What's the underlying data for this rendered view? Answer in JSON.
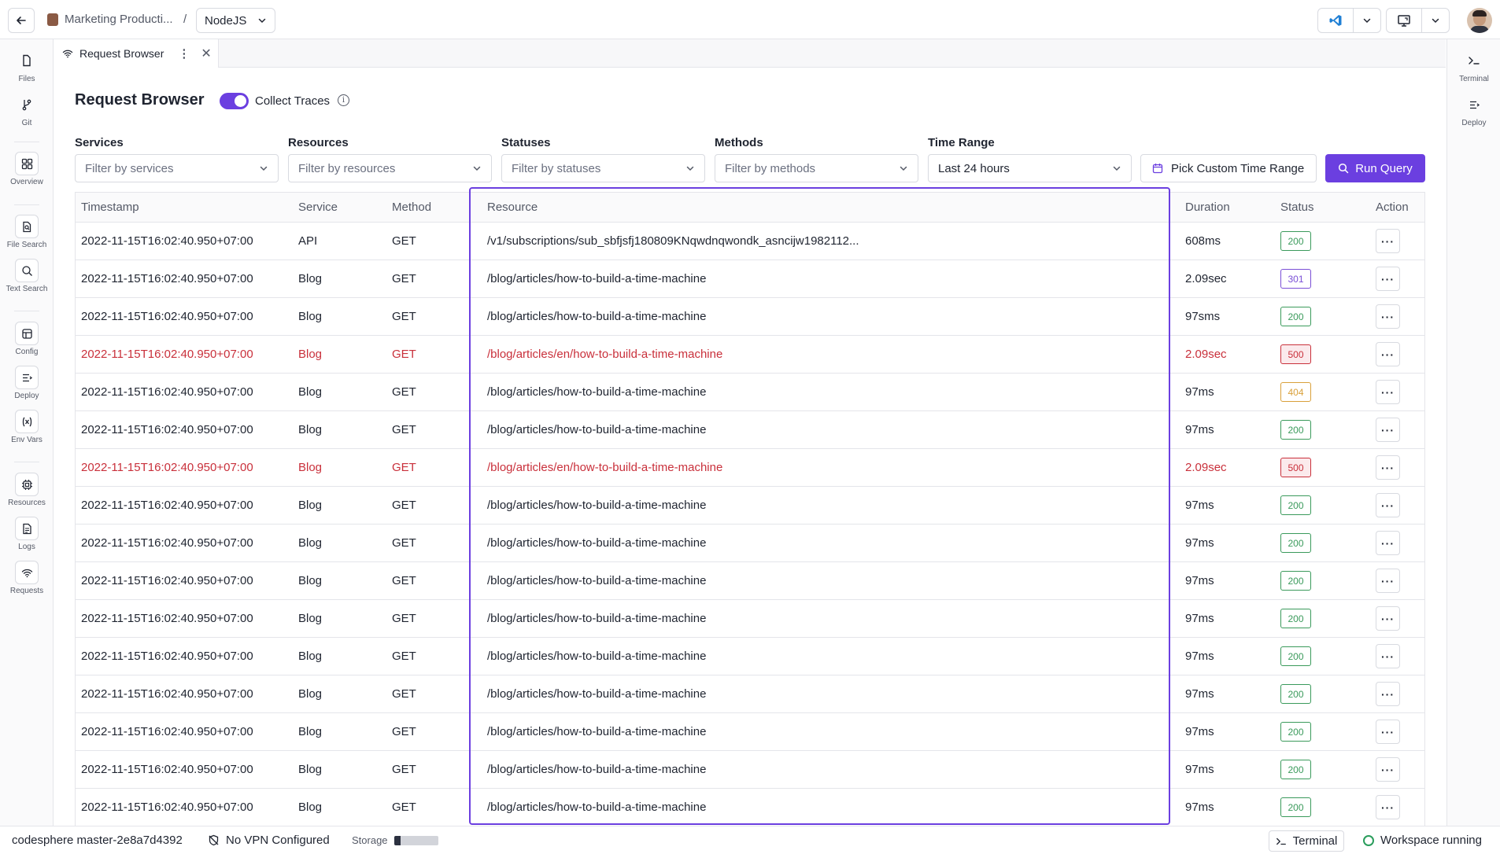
{
  "topbar": {
    "project_name": "Marketing Producti...",
    "separator": "/",
    "env_selected": "NodeJS"
  },
  "leftbar": {
    "items": [
      {
        "label": "Files",
        "icon": "file-icon"
      },
      {
        "label": "Git",
        "icon": "git-branch-icon"
      },
      {
        "label": "Overview",
        "icon": "grid-icon"
      },
      {
        "label": "File Search",
        "icon": "file-search-icon"
      },
      {
        "label": "Text Search",
        "icon": "text-search-icon"
      },
      {
        "label": "Config",
        "icon": "config-icon"
      },
      {
        "label": "Deploy",
        "icon": "deploy-icon"
      },
      {
        "label": "Env Vars",
        "icon": "variable-icon"
      },
      {
        "label": "Resources",
        "icon": "cpu-icon"
      },
      {
        "label": "Logs",
        "icon": "log-icon"
      },
      {
        "label": "Requests",
        "icon": "wifi-icon"
      }
    ]
  },
  "rightbar": {
    "items": [
      {
        "label": "Terminal",
        "icon": "terminal-icon"
      },
      {
        "label": "Deploy",
        "icon": "deploy-icon"
      }
    ]
  },
  "tab": {
    "label": "Request Browser"
  },
  "header": {
    "title": "Request Browser",
    "collect_traces_label": "Collect Traces",
    "collect_traces_on": true
  },
  "filters": {
    "services": {
      "label": "Services",
      "placeholder": "Filter by services"
    },
    "resources": {
      "label": "Resources",
      "placeholder": "Filter by resources"
    },
    "statuses": {
      "label": "Statuses",
      "placeholder": "Filter by statuses"
    },
    "methods": {
      "label": "Methods",
      "placeholder": "Filter by methods"
    },
    "time_range": {
      "label": "Time Range",
      "value": "Last 24 hours"
    },
    "custom_range_label": "Pick Custom Time Range",
    "run_query_label": "Run Query"
  },
  "table": {
    "columns": {
      "timestamp": "Timestamp",
      "service": "Service",
      "method": "Method",
      "resource": "Resource",
      "duration": "Duration",
      "status": "Status",
      "action": "Action"
    },
    "rows": [
      {
        "timestamp": "2022-11-15T16:02:40.950+07:00",
        "service": "API",
        "method": "GET",
        "resource": "/v1/subscriptions/sub_sbfjsfj180809KNqwdnqwondk_asncijw1982112...",
        "duration": "608ms",
        "status": "200",
        "error": false
      },
      {
        "timestamp": "2022-11-15T16:02:40.950+07:00",
        "service": "Blog",
        "method": "GET",
        "resource": "/blog/articles/how-to-build-a-time-machine",
        "duration": "2.09sec",
        "status": "301",
        "error": false
      },
      {
        "timestamp": "2022-11-15T16:02:40.950+07:00",
        "service": "Blog",
        "method": "GET",
        "resource": "/blog/articles/how-to-build-a-time-machine",
        "duration": "97sms",
        "status": "200",
        "error": false
      },
      {
        "timestamp": "2022-11-15T16:02:40.950+07:00",
        "service": "Blog",
        "method": "GET",
        "resource": "/blog/articles/en/how-to-build-a-time-machine",
        "duration": "2.09sec",
        "status": "500",
        "error": true
      },
      {
        "timestamp": "2022-11-15T16:02:40.950+07:00",
        "service": "Blog",
        "method": "GET",
        "resource": "/blog/articles/how-to-build-a-time-machine",
        "duration": "97ms",
        "status": "404",
        "error": false
      },
      {
        "timestamp": "2022-11-15T16:02:40.950+07:00",
        "service": "Blog",
        "method": "GET",
        "resource": "/blog/articles/how-to-build-a-time-machine",
        "duration": "97ms",
        "status": "200",
        "error": false
      },
      {
        "timestamp": "2022-11-15T16:02:40.950+07:00",
        "service": "Blog",
        "method": "GET",
        "resource": "/blog/articles/en/how-to-build-a-time-machine",
        "duration": "2.09sec",
        "status": "500",
        "error": true
      },
      {
        "timestamp": "2022-11-15T16:02:40.950+07:00",
        "service": "Blog",
        "method": "GET",
        "resource": "/blog/articles/how-to-build-a-time-machine",
        "duration": "97ms",
        "status": "200",
        "error": false
      },
      {
        "timestamp": "2022-11-15T16:02:40.950+07:00",
        "service": "Blog",
        "method": "GET",
        "resource": "/blog/articles/how-to-build-a-time-machine",
        "duration": "97ms",
        "status": "200",
        "error": false
      },
      {
        "timestamp": "2022-11-15T16:02:40.950+07:00",
        "service": "Blog",
        "method": "GET",
        "resource": "/blog/articles/how-to-build-a-time-machine",
        "duration": "97ms",
        "status": "200",
        "error": false
      },
      {
        "timestamp": "2022-11-15T16:02:40.950+07:00",
        "service": "Blog",
        "method": "GET",
        "resource": "/blog/articles/how-to-build-a-time-machine",
        "duration": "97ms",
        "status": "200",
        "error": false
      },
      {
        "timestamp": "2022-11-15T16:02:40.950+07:00",
        "service": "Blog",
        "method": "GET",
        "resource": "/blog/articles/how-to-build-a-time-machine",
        "duration": "97ms",
        "status": "200",
        "error": false
      },
      {
        "timestamp": "2022-11-15T16:02:40.950+07:00",
        "service": "Blog",
        "method": "GET",
        "resource": "/blog/articles/how-to-build-a-time-machine",
        "duration": "97ms",
        "status": "200",
        "error": false
      },
      {
        "timestamp": "2022-11-15T16:02:40.950+07:00",
        "service": "Blog",
        "method": "GET",
        "resource": "/blog/articles/how-to-build-a-time-machine",
        "duration": "97ms",
        "status": "200",
        "error": false
      },
      {
        "timestamp": "2022-11-15T16:02:40.950+07:00",
        "service": "Blog",
        "method": "GET",
        "resource": "/blog/articles/how-to-build-a-time-machine",
        "duration": "97ms",
        "status": "200",
        "error": false
      },
      {
        "timestamp": "2022-11-15T16:02:40.950+07:00",
        "service": "Blog",
        "method": "GET",
        "resource": "/blog/articles/how-to-build-a-time-machine",
        "duration": "97ms",
        "status": "200",
        "error": false
      }
    ]
  },
  "status_colors": {
    "200": "#3a9a5b",
    "301": "#7a4fd6",
    "404": "#d9a03a",
    "500": "#c9303b"
  },
  "colors": {
    "accent": "#6b3fe0",
    "error_text": "#c9303b",
    "running": "#2a9d5c"
  },
  "statusbar": {
    "branch": "codesphere master-2e8a7d4392",
    "vpn": "No VPN Configured",
    "storage_label": "Storage",
    "storage_fraction": 0.15,
    "terminal_label": "Terminal",
    "workspace_status": "Workspace running"
  }
}
